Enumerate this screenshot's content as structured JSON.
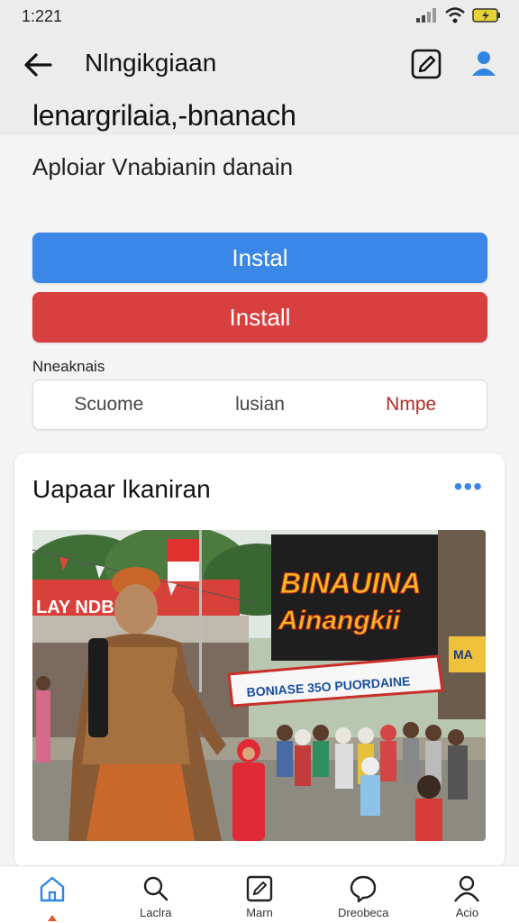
{
  "status": {
    "time": "1:221"
  },
  "header": {
    "title": "Nlngikgiaan"
  },
  "headline": "lenargrilaia,-bnanach",
  "subline": "Aploiar Vnabianin danain",
  "buttons": {
    "primary": "Instal",
    "secondary": "Install"
  },
  "segments": {
    "label": "Nneaknais",
    "items": [
      "Scuome",
      "lusian",
      "Nmpe"
    ],
    "active_index": 2
  },
  "card": {
    "title": "Uapaar lkaniran",
    "banner_main_line1": "BINAUINA",
    "banner_main_line2": "Ainangkii",
    "banner_street": "BONIASE 35O PUORDAINE",
    "banner_left": "LAY NDBEAR",
    "banner_right": "MA"
  },
  "nav": {
    "items": [
      {
        "label": "",
        "icon": "home-icon"
      },
      {
        "label": "Laclra",
        "icon": "search-icon"
      },
      {
        "label": "Marn",
        "icon": "edit-icon"
      },
      {
        "label": "Dreobeca",
        "icon": "chat-icon"
      },
      {
        "label": "Acio",
        "icon": "profile-icon"
      }
    ]
  },
  "colors": {
    "accent_blue": "#3a87e8",
    "accent_red": "#d7403f",
    "active_red": "#b22a25"
  }
}
